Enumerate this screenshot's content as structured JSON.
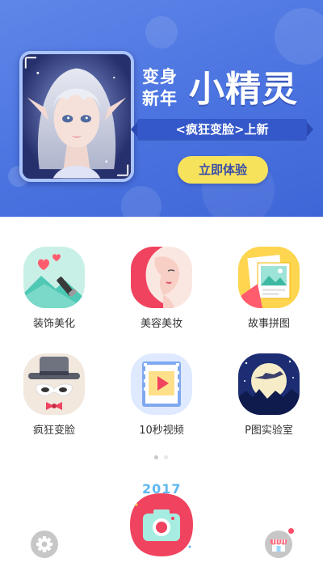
{
  "banner": {
    "title_small_line1": "变身",
    "title_small_line2": "新年",
    "title_big": "小精灵",
    "subtitle": "<疯狂变脸>上新",
    "cta_label": "立即体验"
  },
  "features": [
    {
      "label": "装饰美化",
      "icon": "decorate-icon"
    },
    {
      "label": "美容美妆",
      "icon": "beauty-makeup-icon"
    },
    {
      "label": "故事拼图",
      "icon": "story-collage-icon"
    },
    {
      "label": "疯狂变脸",
      "icon": "crazy-face-icon"
    },
    {
      "label": "10秒视频",
      "icon": "video-icon"
    },
    {
      "label": "P图实验室",
      "icon": "lab-icon"
    }
  ],
  "pager": {
    "total": 2,
    "current": 1
  },
  "bottom_bar": {
    "year_badge": "2017",
    "settings_icon": "gear-icon",
    "camera_icon": "camera-icon",
    "store_icon": "store-icon",
    "store_has_notification": true
  },
  "colors": {
    "banner_blue": "#4a73e0",
    "cta_yellow": "#f7e25b",
    "camera_red": "#f0435f",
    "icon_gray": "#c7c7c7"
  }
}
